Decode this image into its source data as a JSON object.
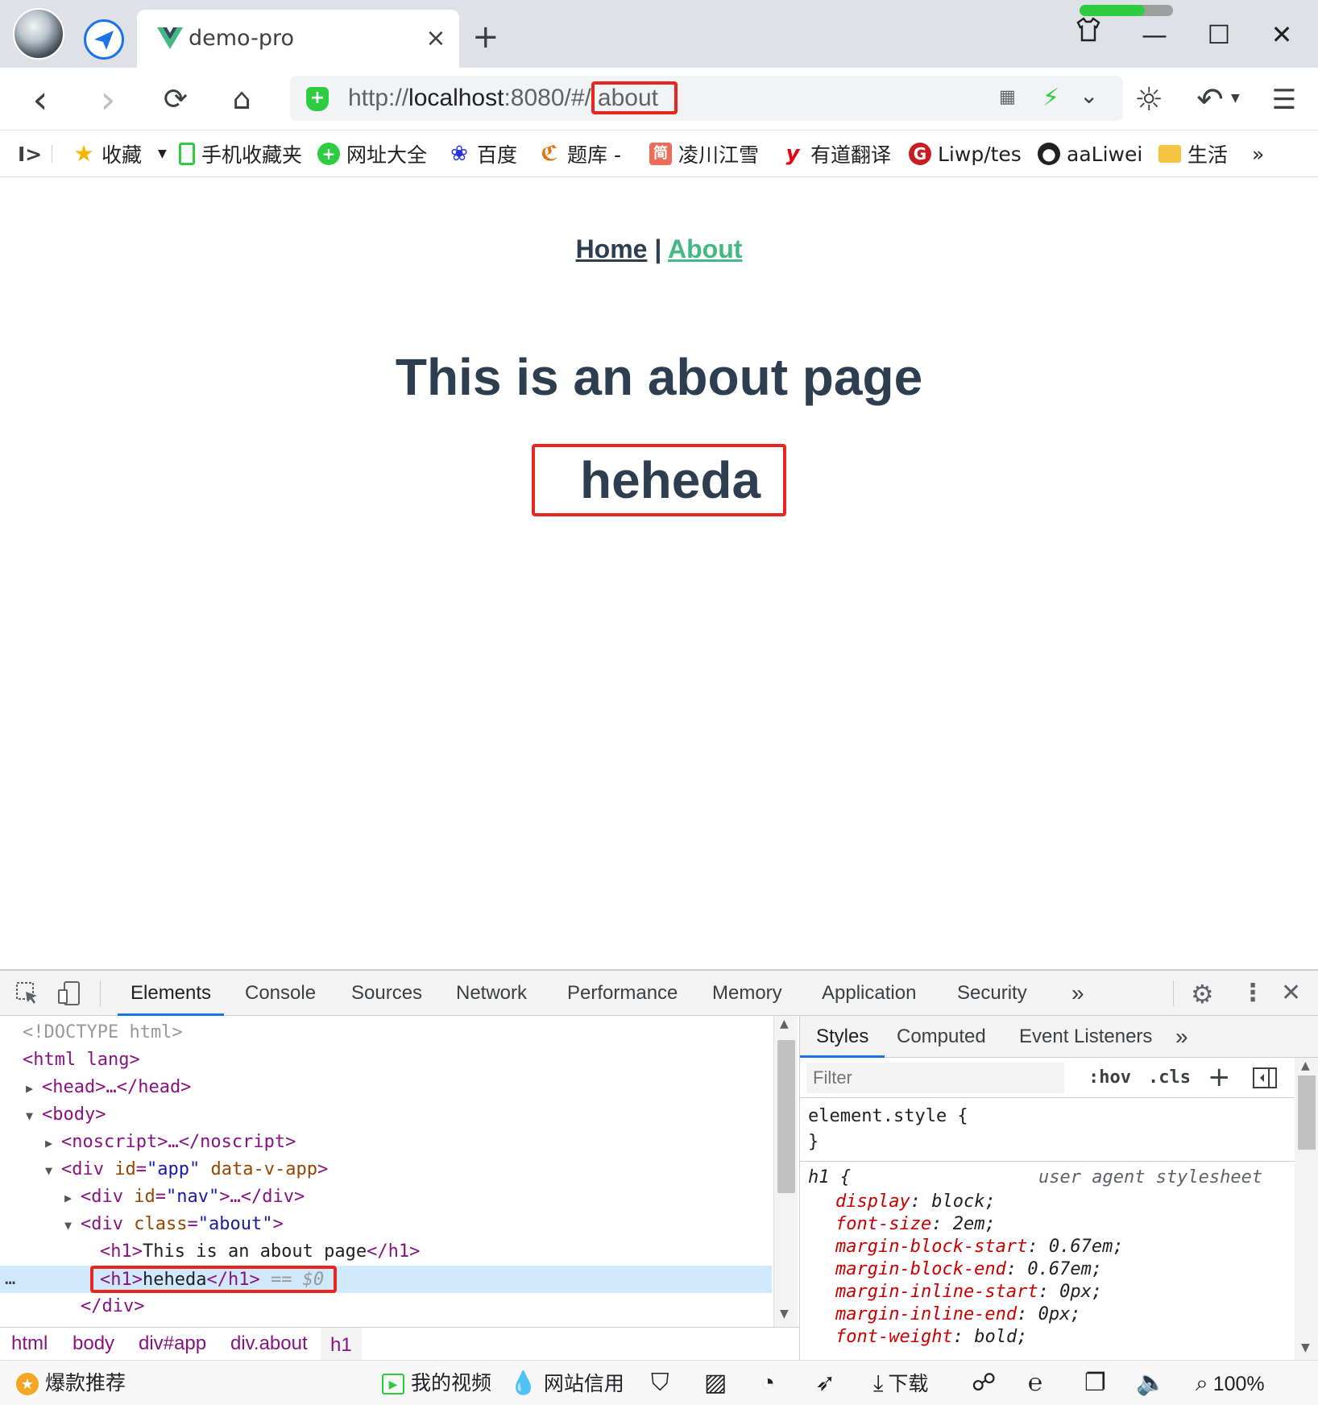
{
  "tab": {
    "title": "demo-pro",
    "close": "×",
    "new_tab": "+"
  },
  "window": {
    "minimize": "—",
    "maximize": "☐",
    "close": "✕",
    "shirt": "⌂"
  },
  "progress": {
    "fraction": 0.7
  },
  "nav": {
    "back": "‹",
    "forward": "›",
    "reload": "⟳",
    "home": "⌂"
  },
  "address": {
    "scheme": "http://",
    "host": "localhost",
    "rest": ":8080/#/",
    "path": "about"
  },
  "toolbar_icons": {
    "brightness": "☼",
    "undo": "↶",
    "menu": "☰",
    "qr": "▦",
    "bolt": "⚡",
    "chevron": "⌄"
  },
  "bookmarks": {
    "toggle": "I>",
    "items": [
      "收藏",
      "手机收藏夹",
      "网址大全",
      "百度",
      "题库 -",
      "凌川江雪",
      "有道翻译",
      "Liwp/tes",
      "aaLiwei",
      "生活"
    ],
    "more": "»"
  },
  "page": {
    "nav_home": "Home",
    "nav_sep": " | ",
    "nav_about": "About",
    "h1_title": "This is an about page",
    "h1_heheda": "heheda"
  },
  "devtools": {
    "tabs": [
      "Elements",
      "Console",
      "Sources",
      "Network",
      "Performance",
      "Memory",
      "Application",
      "Security",
      "»"
    ],
    "dom": {
      "doctype": "<!DOCTYPE html>",
      "html_open": "<html lang>",
      "head": "<head>…</head>",
      "body_open": "<body>",
      "noscript": "<noscript>…</noscript>",
      "div_app": {
        "tag": "div",
        "attr1": "id",
        "val1": "\"app\"",
        "attr2": "data-v-app"
      },
      "div_nav": {
        "tag": "div",
        "attr": "id",
        "val": "\"nav\"",
        "rest": ">…</div>"
      },
      "div_about": {
        "tag": "div",
        "attr": "class",
        "val": "\"about\""
      },
      "h1_1": {
        "open": "<h1>",
        "text": "This is an about page",
        "close": "</h1>"
      },
      "h1_2": {
        "open": "<h1>",
        "text": "heheda",
        "close": "</h1>",
        "marker": " == $0"
      },
      "div_close": "</div>",
      "dots": "…"
    },
    "breadcrumbs": [
      "html",
      "body",
      "div#app",
      "div.about",
      "h1"
    ],
    "styles": {
      "tabs": [
        "Styles",
        "Computed",
        "Event Listeners",
        "»"
      ],
      "filter_placeholder": "Filter",
      "hov": ":hov",
      "cls": ".cls",
      "plus": "+",
      "element_style_open": "element.style {",
      "element_style_close": "}",
      "rule_selector": "h1 {",
      "rule_source": "user agent stylesheet",
      "props": [
        {
          "name": "display",
          "value": "block;"
        },
        {
          "name": "font-size",
          "value": "2em;"
        },
        {
          "name": "margin-block-start",
          "value": "0.67em;"
        },
        {
          "name": "margin-block-end",
          "value": "0.67em;"
        },
        {
          "name": "margin-inline-start",
          "value": "0px;"
        },
        {
          "name": "margin-inline-end",
          "value": "0px;"
        },
        {
          "name": "font-weight",
          "value": "bold;"
        }
      ]
    }
  },
  "statusbar": {
    "promo": "爆款推荐",
    "video": "我的视频",
    "credit": "网站信用",
    "download": "下载",
    "zoom": "100%"
  },
  "colors": {
    "vue_green": "#42b983",
    "vue_dark": "#2c3e50",
    "highlight_red": "#e8261f"
  }
}
